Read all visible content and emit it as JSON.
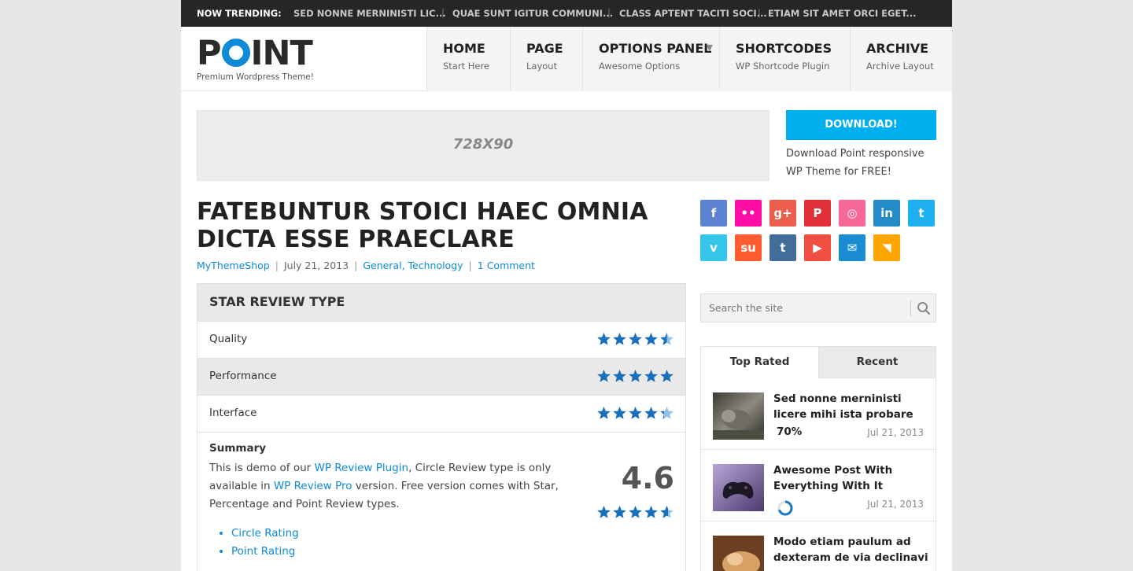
{
  "trending": {
    "label": "NOW TRENDING:",
    "items": [
      "SED NONNE MERNINISTI LIC...",
      "QUAE SUNT IGITUR COMMUNI...",
      "CLASS APTENT TACITI SOCI...",
      "ETIAM SIT AMET ORCI EGET..."
    ]
  },
  "header": {
    "logo_pre": "P",
    "logo_post": "INT",
    "tagline": "Premium Wordpress Theme!",
    "menu": [
      {
        "title": "HOME",
        "sub": "Start Here"
      },
      {
        "title": "PAGE",
        "sub": "Layout"
      },
      {
        "title": "OPTIONS PANEL",
        "sub": "Awesome Options",
        "arrow": "▼"
      },
      {
        "title": "SHORTCODES",
        "sub": "WP Shortcode Plugin"
      },
      {
        "title": "ARCHIVE",
        "sub": "Archive Layout"
      }
    ]
  },
  "banner": {
    "ad_text": "728X90",
    "download_label": "DOWNLOAD!",
    "download_text": "Download Point responsive WP Theme for FREE!"
  },
  "article": {
    "title": "FATEBUNTUR STOICI HAEC OMNIA DICTA ESSE PRAECLARE",
    "author": "MyThemeShop",
    "date": "July 21, 2013",
    "categories": "General, Technology",
    "comments": "1 Comment"
  },
  "review": {
    "heading": "STAR REVIEW TYPE",
    "rows": [
      {
        "label": "Quality",
        "rating": 4.5
      },
      {
        "label": "Performance",
        "rating": 5
      },
      {
        "label": "Interface",
        "rating": 4.3
      }
    ],
    "summary_heading": "Summary",
    "summary_pre": "This is demo of our ",
    "summary_link1": "WP Review Plugin",
    "summary_mid": ", Circle Review type is only available in ",
    "summary_link2": "WP Review Pro",
    "summary_post": " version. Free version comes with Star, Percentage and Point Review types.",
    "score": "4.6",
    "score_rating": 4.6,
    "list": [
      "Circle Rating",
      "Point Rating"
    ]
  },
  "social": {
    "icons": [
      {
        "name": "facebook-icon",
        "glyph": "f",
        "color": "#5d82d1"
      },
      {
        "name": "flickr-icon",
        "glyph": "••",
        "color": "#ff0ea5"
      },
      {
        "name": "google-plus-icon",
        "glyph": "g+",
        "color": "#eb5e4c"
      },
      {
        "name": "pinterest-icon",
        "glyph": "P",
        "color": "#e13138"
      },
      {
        "name": "dribbble-icon",
        "glyph": "◎",
        "color": "#f7679a"
      },
      {
        "name": "linkedin-icon",
        "glyph": "in",
        "color": "#238cc8"
      },
      {
        "name": "twitter-icon",
        "glyph": "t",
        "color": "#1eb0ee"
      },
      {
        "name": "vimeo-icon",
        "glyph": "v",
        "color": "#35c6ea"
      },
      {
        "name": "stumbleupon-icon",
        "glyph": "su",
        "color": "#ff5c30"
      },
      {
        "name": "tumblr-icon",
        "glyph": "t",
        "color": "#426d9b"
      },
      {
        "name": "youtube-icon",
        "glyph": "▶",
        "color": "#ef4e41"
      },
      {
        "name": "email-icon",
        "glyph": "✉",
        "color": "#1a8dd2"
      },
      {
        "name": "rss-icon",
        "glyph": "◥",
        "color": "#ffa500"
      }
    ]
  },
  "search": {
    "placeholder": "Search the site"
  },
  "widget": {
    "tabs": [
      "Top Rated",
      "Recent"
    ],
    "posts": [
      {
        "title": "Sed nonne merninisti licere mihi ista probare",
        "score": "70%",
        "date": "Jul 21, 2013"
      },
      {
        "title": "Awesome Post With Everything With It",
        "date": "Jul 21, 2013",
        "circle_rating": 0.7
      },
      {
        "title": "Modo etiam paulum ad dexteram de via declinavi",
        "date": ""
      }
    ]
  },
  "colors": {
    "accent": "#0d8ad8",
    "star": "#1a6fba",
    "download": "#00b0ee"
  }
}
